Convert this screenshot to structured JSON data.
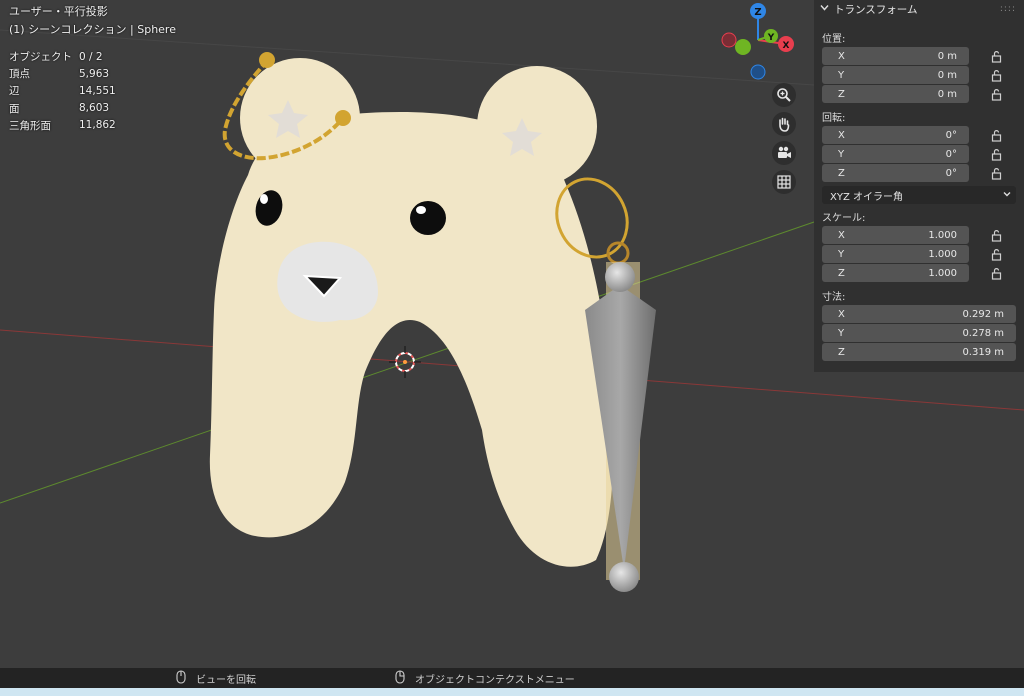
{
  "viewport": {
    "view_mode": "ユーザー・平行投影",
    "collection": "(1) シーンコレクション | Sphere",
    "stats": [
      {
        "label": "オブジェクト",
        "value": "0 / 2"
      },
      {
        "label": "頂点",
        "value": "5,963"
      },
      {
        "label": "辺",
        "value": "14,551"
      },
      {
        "label": "面",
        "value": "8,603"
      },
      {
        "label": "三角形面",
        "value": "11,862"
      }
    ]
  },
  "gizmo": {
    "z_label": "Z",
    "y_label": "Y",
    "x_label": "X"
  },
  "nav_buttons": [
    {
      "icon": "zoom-icon"
    },
    {
      "icon": "hand-icon"
    },
    {
      "icon": "camera-icon"
    },
    {
      "icon": "grid-icon"
    }
  ],
  "panel": {
    "title": "トランスフォーム",
    "location": {
      "label": "位置:",
      "x": "0 m",
      "y": "0 m",
      "z": "0 m"
    },
    "rotation": {
      "label": "回転:",
      "x": "0°",
      "y": "0°",
      "z": "0°"
    },
    "rotation_mode": "XYZ オイラー角",
    "scale": {
      "label": "スケール:",
      "x": "1.000",
      "y": "1.000",
      "z": "1.000"
    },
    "dimensions": {
      "label": "寸法:",
      "x": "0.292 m",
      "y": "0.278 m",
      "z": "0.319 m"
    },
    "axis_x": "X",
    "axis_y": "Y",
    "axis_z": "Z"
  },
  "statusbar": {
    "rotate_view": "ビューを回転",
    "context_menu": "オブジェクトコンテクストメニュー"
  },
  "colors": {
    "bear_body": "#f1e6c7",
    "x_axis": "#e83e4e",
    "y_axis": "#6fb523",
    "z_axis": "#2f86e6",
    "gold": "#d2a431"
  }
}
